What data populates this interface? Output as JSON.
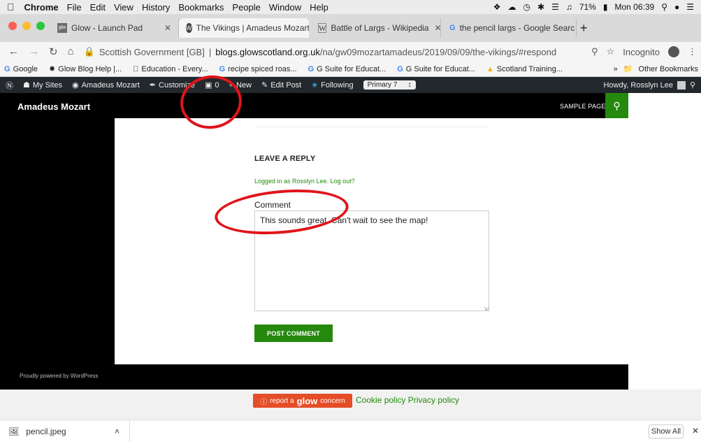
{
  "menubar": {
    "apple": "",
    "app": "Chrome",
    "items": [
      "File",
      "Edit",
      "View",
      "History",
      "Bookmarks",
      "People",
      "Window",
      "Help"
    ],
    "battery": "71%",
    "clock": "Mon 06:39"
  },
  "tabs": [
    {
      "label": "Glow - Launch Pad",
      "favicon": "glow"
    },
    {
      "label": "The Vikings | Amadeus Mozart",
      "favicon": "wp"
    },
    {
      "label": "Battle of Largs - Wikipedia",
      "favicon": "W"
    },
    {
      "label": "the pencil largs - Google Searc",
      "favicon": "G"
    }
  ],
  "address": {
    "security": "Scottish Government [GB]",
    "host": "blogs.glowscotland.org.uk",
    "path": "/na/gw09mozartamadeus/2019/09/09/the-vikings/#respond",
    "incognito": "Incognito"
  },
  "bookmarks": {
    "items": [
      "Google",
      "Glow Blog Help |...",
      "Education - Every...",
      "recipe spiced roas...",
      "G Suite for Educat...",
      "G Suite for Educat...",
      "Scotland Training..."
    ],
    "overflow": "»",
    "other": "Other Bookmarks"
  },
  "wpbar": {
    "my_sites": "My Sites",
    "site": "Amadeus Mozart",
    "customize": "Customize",
    "comments": "0",
    "new": "New",
    "edit": "Edit Post",
    "following": "Following",
    "select": "Primary 7",
    "howdy": "Howdy, Rosslyn Lee"
  },
  "site": {
    "title": "Amadeus Mozart",
    "nav": "SAMPLE PAGE",
    "reply_title": "LEAVE A REPLY",
    "logged_in": "Logged in as Rosslyn Lee. Log out?",
    "comment_label": "Comment",
    "comment_value": "This sounds great. Can't wait to see the map!",
    "submit": "POST COMMENT",
    "powered": "Proudly powered by WordPress"
  },
  "glow_footer": {
    "report_prefix": "report a",
    "report_brand": "glow",
    "report_suffix": "concern",
    "policies": "Cookie policy Privacy policy"
  },
  "downloads": {
    "file": "pencil.jpeg",
    "show_all": "Show All"
  },
  "colors": {
    "wp_green": "#24890d",
    "annotation_red": "#e0141b"
  }
}
